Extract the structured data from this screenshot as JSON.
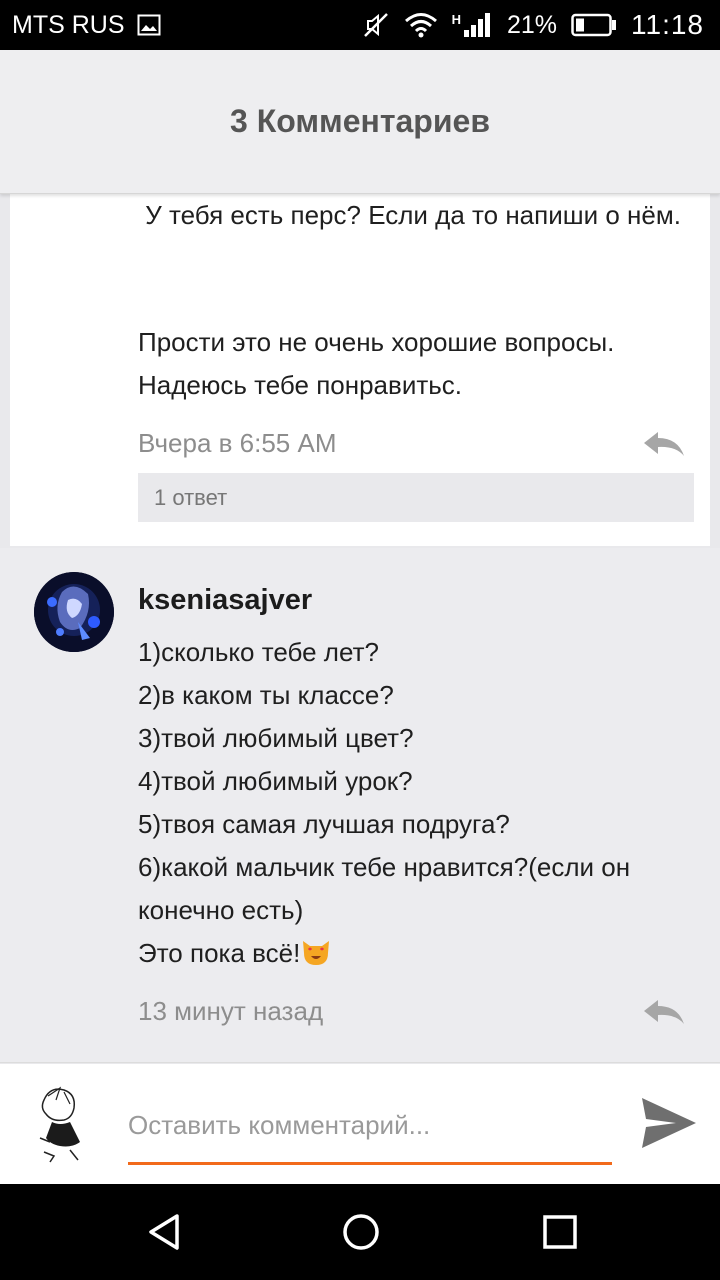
{
  "status_bar": {
    "carrier": "MTS RUS",
    "network": "H",
    "battery_percent": "21%",
    "time": "11:18",
    "icons": [
      "image-icon",
      "mute-icon",
      "wifi-icon",
      "signal-icon",
      "battery-icon"
    ]
  },
  "header": {
    "title": "3 Комментариев"
  },
  "comments": [
    {
      "paragraphs": [
        " У тебя есть перс? Если да то напиши о нём.",
        "Прости это не очень хорошие вопросы. Надеюсь тебе понравитьс."
      ],
      "time": "Вчера в 6:55 AM",
      "replies_label": "1 ответ"
    },
    {
      "username": "kseniasajver",
      "lines": [
        "1)сколько тебе лет?",
        "2)в каком ты классе?",
        "3)твой любимый цвет?",
        "4)твой любимый урок?",
        "5)твоя самая лучшая подруга?",
        "6)какой мальчик тебе нравится?(если он конечно есть)",
        "Это пока всё!"
      ],
      "time": "13 минут назад"
    }
  ],
  "input": {
    "placeholder": "Оставить комментарий...",
    "accent_color": "#f26a1b"
  }
}
